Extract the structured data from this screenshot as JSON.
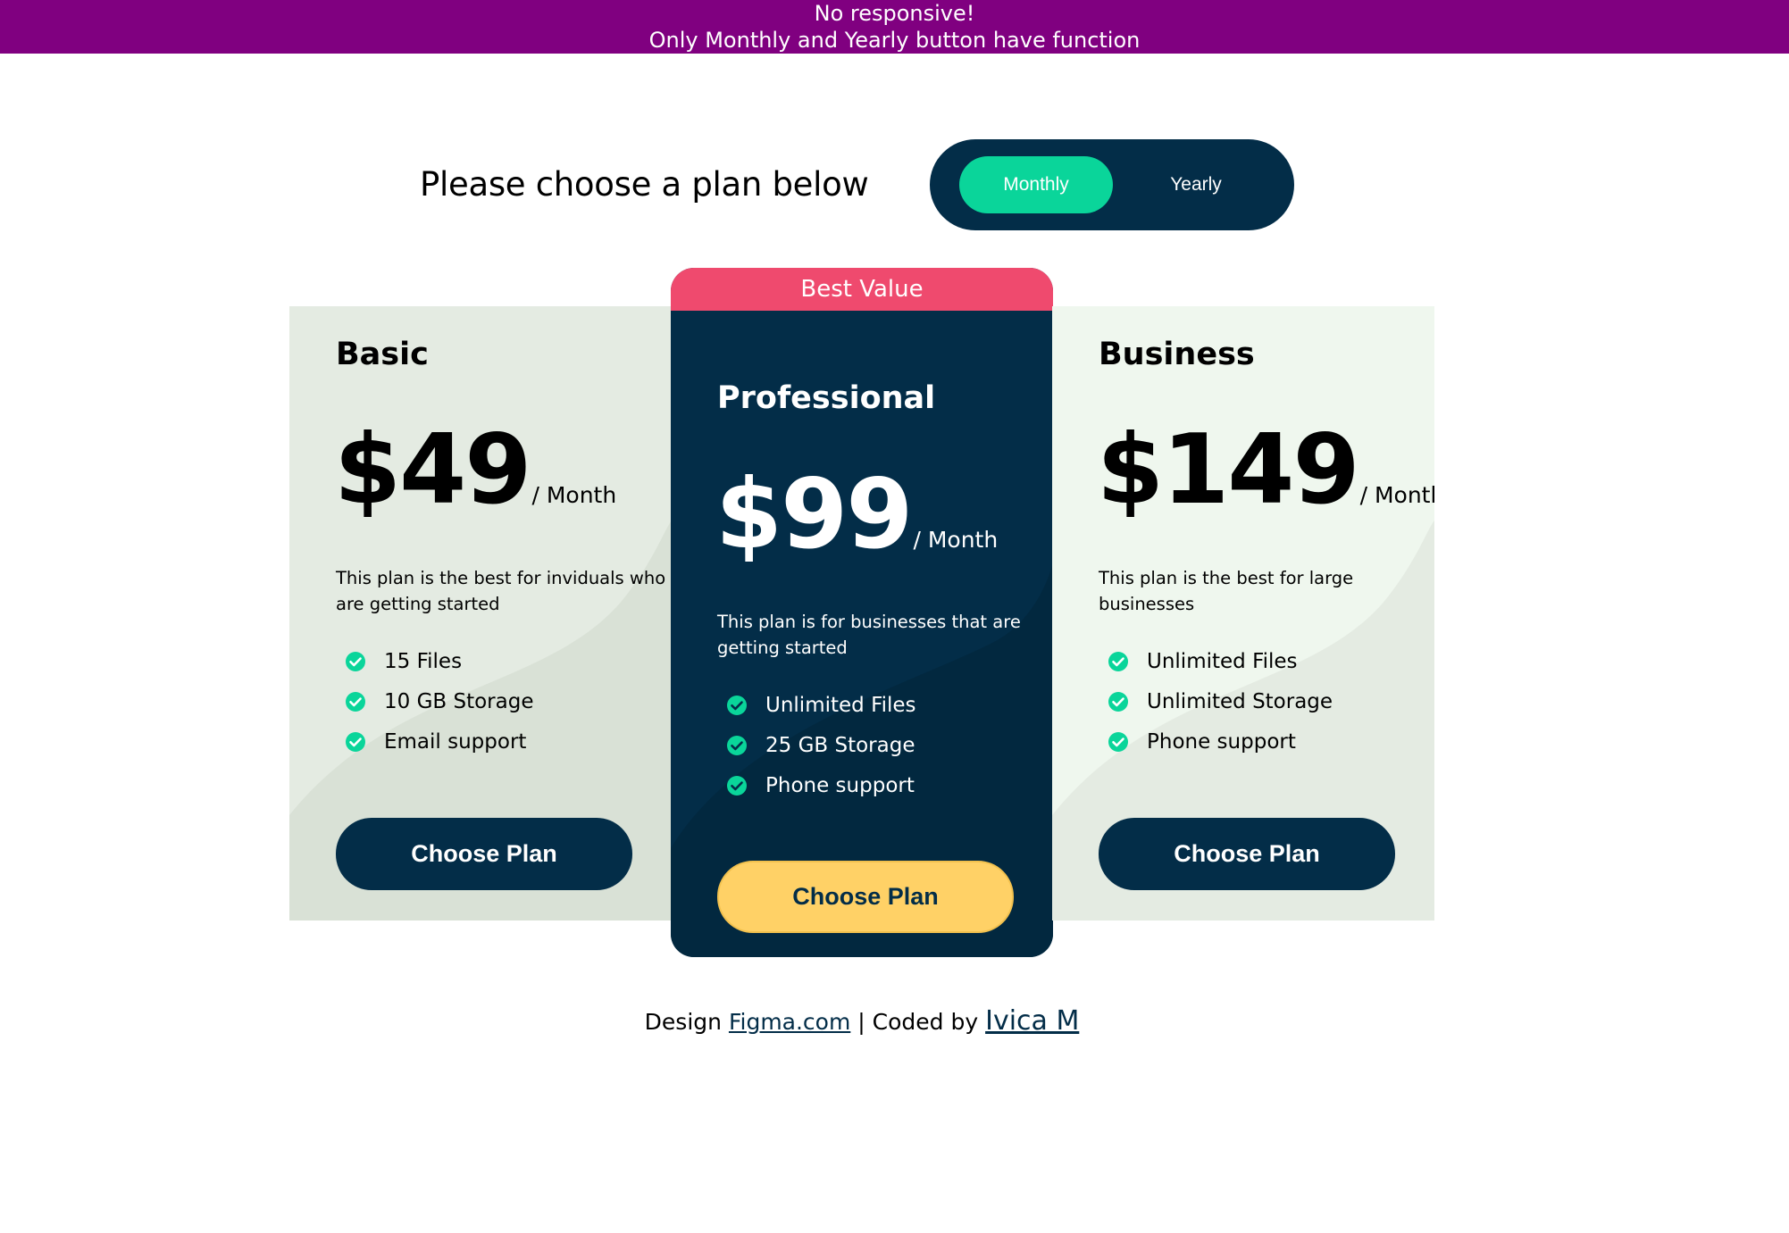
{
  "notice": {
    "line1": "No responsive!",
    "line2": "Only Monthly and Yearly button have function"
  },
  "header": {
    "title": "Please choose a plan below",
    "toggle": {
      "monthly": "Monthly",
      "yearly": "Yearly",
      "active": "Monthly"
    }
  },
  "plans": [
    {
      "name": "Basic",
      "price": "$49",
      "period": "/ Month",
      "description": "This plan is the best for inviduals who are getting started",
      "features": [
        "15 Files",
        "10 GB Storage",
        "Email support"
      ],
      "cta": "Choose Plan"
    },
    {
      "badge": "Best Value",
      "name": "Professional",
      "price": "$99",
      "period": "/ Month",
      "description": "This plan is for businesses that are getting started",
      "features": [
        "Unlimited Files",
        "25 GB Storage",
        "Phone support"
      ],
      "cta": "Choose Plan"
    },
    {
      "name": "Business",
      "price": "$149",
      "period": "/ Month",
      "description": "This plan is the best for large businesses",
      "features": [
        "Unlimited Files",
        "Unlimited Storage",
        "Phone support"
      ],
      "cta": "Choose Plan"
    }
  ],
  "footer": {
    "design_prefix": "Design",
    "design_link": "Figma.com",
    "separator": "| Coded by",
    "author_link": "Ivica M"
  },
  "colors": {
    "banner": "#800080",
    "navy": "#032d48",
    "accent_green": "#0ad59a",
    "ribbon_pink": "#ef4a6e",
    "gold": "#ffd166",
    "card_basic": "#e4ebe2",
    "card_business": "#eff7ee"
  },
  "icons": {
    "feature_check": "check-circle-icon"
  }
}
